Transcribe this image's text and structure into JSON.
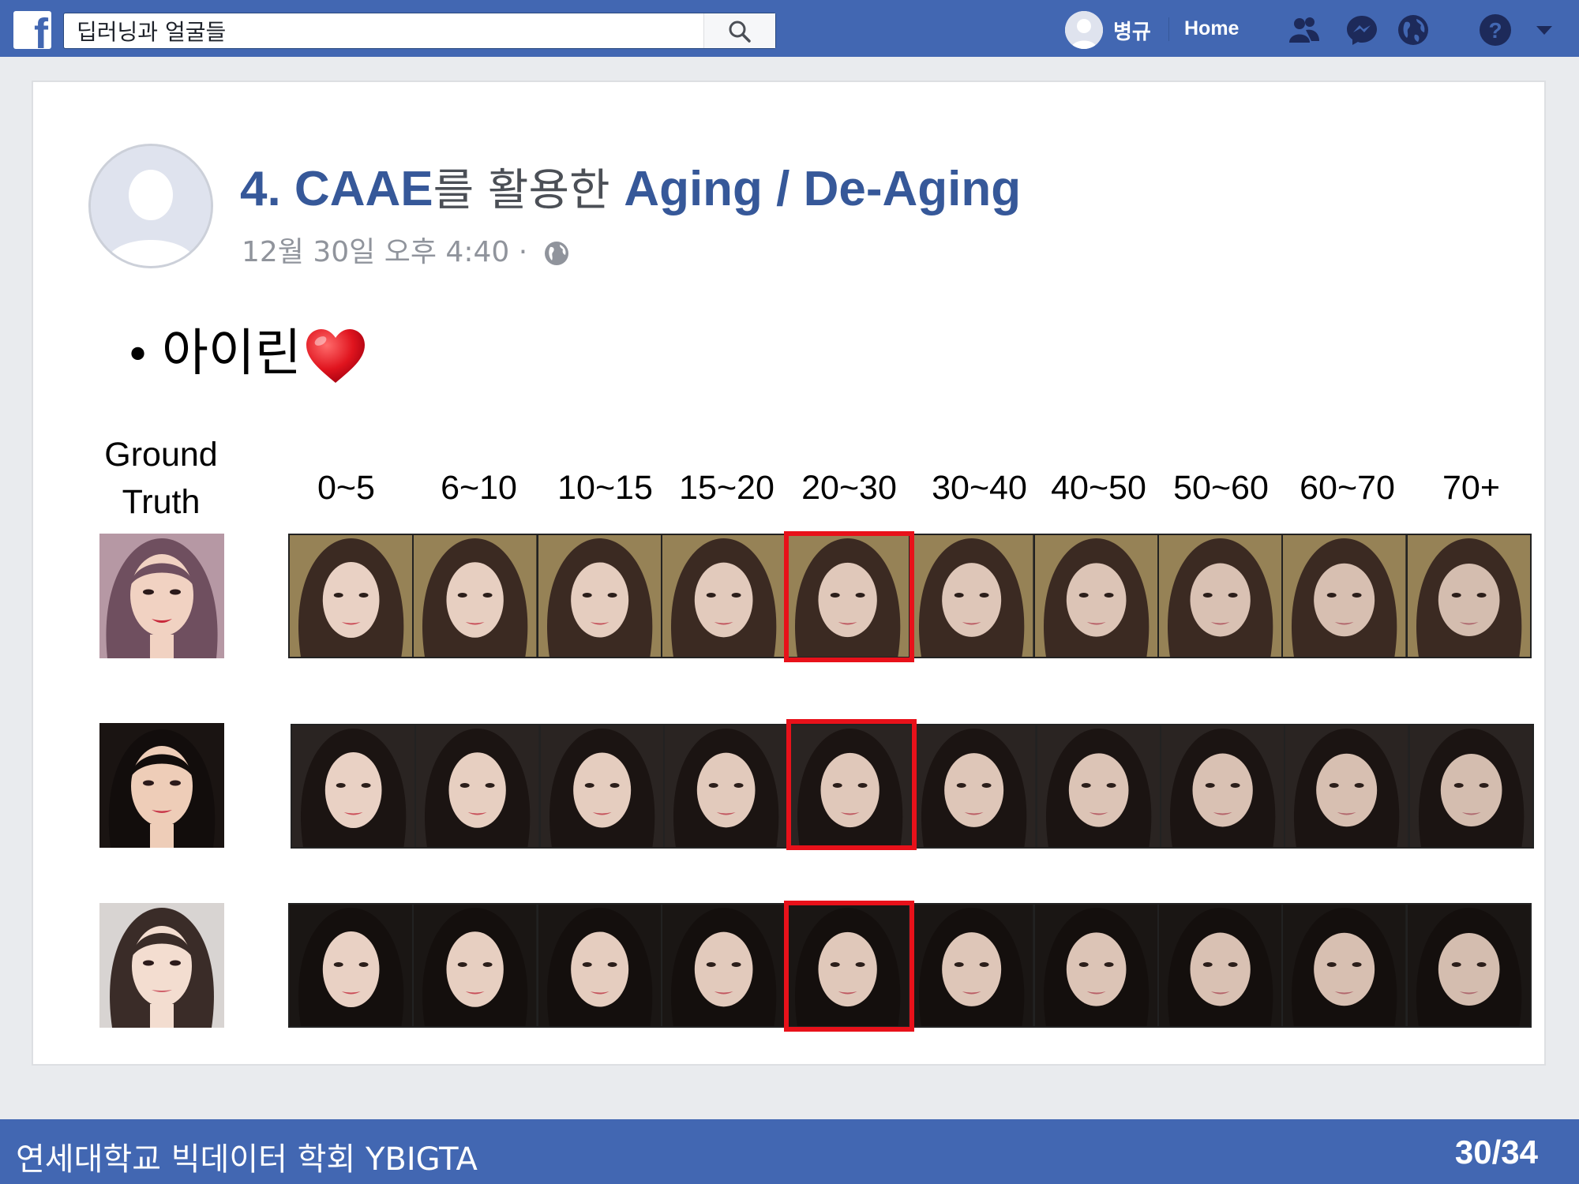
{
  "topbar": {
    "logo_letter": "f",
    "search_value": "딥러닝과 얼굴들",
    "user_name": "병규",
    "home_label": "Home"
  },
  "post": {
    "title_prefix": "4. CAAE",
    "title_kr": "를 활용한 ",
    "title_suffix": "Aging / De-Aging",
    "date": "12월 30일 오후 4:40 ·",
    "bullet_text": "아이린"
  },
  "grid": {
    "ground_truth_line1": "Ground",
    "ground_truth_line2": "Truth",
    "age_groups": [
      "0~5",
      "6~10",
      "10~15",
      "15~20",
      "20~30",
      "30~40",
      "40~50",
      "50~60",
      "60~70",
      "70+"
    ],
    "highlighted_age": "20~30",
    "rows": 3
  },
  "footer": {
    "org": "연세대학교 빅데이터 학회 YBIGTA",
    "page": "30/34"
  },
  "colors": {
    "brand": "#4267b2",
    "highlight": "#e8111a",
    "title": "#365899"
  },
  "icons": [
    "search-icon",
    "friends-icon",
    "messenger-icon",
    "globe-icon",
    "help-icon",
    "chevron-down-icon",
    "heart-icon"
  ]
}
